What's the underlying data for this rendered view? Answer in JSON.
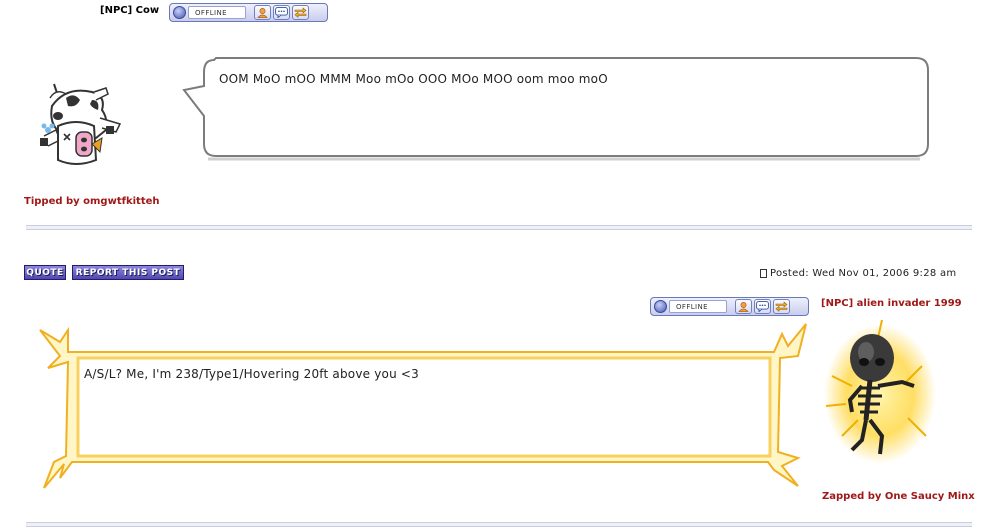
{
  "post1": {
    "username": "[NPC] Cow",
    "status": "OFFLINE",
    "message": "OOM MoO mOO MMM Moo mOo OOO MOo MOO oom moo moO",
    "tip_line": "Tipped by omgwtfkitteh"
  },
  "post2": {
    "quote_label": "QUOTE",
    "report_label": "REPORT THIS POST",
    "posted_label": "Posted: Wed Nov 01, 2006 9:28 am",
    "username": "[NPC] alien invader 1999",
    "status": "OFFLINE",
    "message": "A/S/L? Me, I'm 238/Type1/Hovering 20ft above you <3",
    "zap_line": "Zapped by One Saucy Minx"
  }
}
